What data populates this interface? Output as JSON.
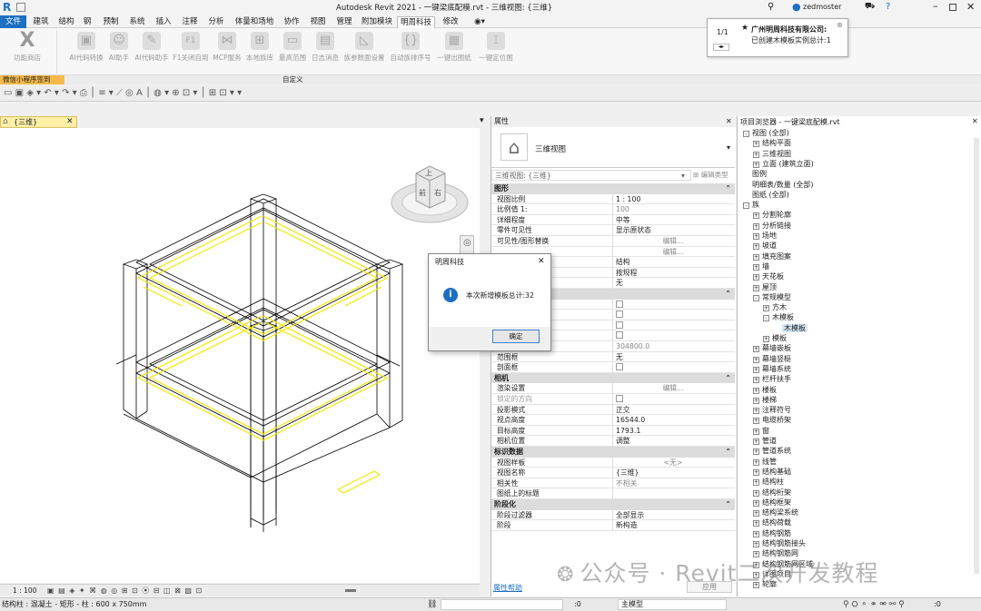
{
  "titlebar": {
    "title": "Autodesk Revit 2021 - 一键梁底配模.rvt - 三维视图: {三维}",
    "user": "zedmoster"
  },
  "ribbon_tabs": [
    "文件",
    "建筑",
    "结构",
    "钢",
    "预制",
    "系统",
    "插入",
    "注释",
    "分析",
    "体量和场地",
    "协作",
    "视图",
    "管理",
    "附加模块",
    "明周科技",
    "修改"
  ],
  "active_tab": "明周科技",
  "ribbon_buttons": [
    "功能商店",
    "AI代码转换",
    "AI助手",
    "AI代码助手",
    "F1关闭自用",
    "MCP服务",
    "本地族库",
    "最高范围",
    "日志消息",
    "族参数面设置",
    "自动族排序号",
    "一键出图纸",
    "一键定位图"
  ],
  "panel_labels": {
    "left": "微信小程序签到",
    "center": "自定义"
  },
  "notification": {
    "count": "1/1",
    "company": "广州明周科技有限公司:",
    "message": "已创建木模板实例总计:1"
  },
  "view_tab": "{三维}",
  "view_control": {
    "scale": "1 : 100"
  },
  "properties": {
    "header": "属性",
    "type_name": "三维视图",
    "selector": "三维视图: {三维}",
    "edit_type": "编辑类型",
    "rows": [
      {
        "kind": "sec",
        "k": "图形"
      },
      {
        "k": "视图比例",
        "v": "1 : 100"
      },
      {
        "k": "比例值 1:",
        "v": "100",
        "dim": true
      },
      {
        "k": "详细程度",
        "v": "中等"
      },
      {
        "k": "零件可见性",
        "v": "显示原状态"
      },
      {
        "k": "可见性/图形替换",
        "v": "编辑...",
        "btn": true
      },
      {
        "k": "",
        "v": "编辑...",
        "btn": true
      },
      {
        "k": "",
        "v": "结构"
      },
      {
        "k": "",
        "v": "按规程"
      },
      {
        "k": "",
        "v": "无"
      },
      {
        "kind": "sec",
        "k": ""
      },
      {
        "k": "",
        "v": "",
        "chk": true
      },
      {
        "k": "",
        "v": "",
        "chk": true
      },
      {
        "k": "",
        "v": "",
        "chk": true
      },
      {
        "k": "",
        "v": "",
        "chk": true
      },
      {
        "k": "远剪裁偏移",
        "v": "304800.0",
        "dim": true
      },
      {
        "k": "范围框",
        "v": "无"
      },
      {
        "k": "剖面框",
        "v": "",
        "chk": true
      },
      {
        "kind": "sec",
        "k": "相机"
      },
      {
        "k": "渲染设置",
        "v": "编辑...",
        "btn": true
      },
      {
        "k": "锁定的方向",
        "v": "",
        "chk": true,
        "dimk": true
      },
      {
        "k": "投影模式",
        "v": "正交"
      },
      {
        "k": "视点高度",
        "v": "16544.0"
      },
      {
        "k": "目标高度",
        "v": "1793.1"
      },
      {
        "k": "相机位置",
        "v": "调整"
      },
      {
        "kind": "sec",
        "k": "标识数据"
      },
      {
        "k": "视图样板",
        "v": "<无>",
        "btn": true
      },
      {
        "k": "视图名称",
        "v": "{三维}"
      },
      {
        "k": "相关性",
        "v": "不相关",
        "dim": true
      },
      {
        "k": "图纸上的标题",
        "v": ""
      },
      {
        "kind": "sec",
        "k": "阶段化"
      },
      {
        "k": "阶段过滤器",
        "v": "全部显示"
      },
      {
        "k": "阶段",
        "v": "新构造"
      }
    ],
    "help": "属性帮助",
    "apply": "应用"
  },
  "browser": {
    "title": "项目浏览器 - 一键梁底配模.rvt",
    "items": [
      {
        "t": "视图 (全部)",
        "l": 0,
        "e": "-"
      },
      {
        "t": "结构平面",
        "l": 1,
        "e": "+"
      },
      {
        "t": "三维视图",
        "l": 1,
        "e": "+"
      },
      {
        "t": "立面 (建筑立面)",
        "l": 1,
        "e": "+"
      },
      {
        "t": "图例",
        "l": 0,
        "e": ""
      },
      {
        "t": "明细表/数量 (全部)",
        "l": 0,
        "e": ""
      },
      {
        "t": "图纸 (全部)",
        "l": 0,
        "e": ""
      },
      {
        "t": "族",
        "l": 0,
        "e": "-"
      },
      {
        "t": "分割轮廓",
        "l": 1,
        "e": "+"
      },
      {
        "t": "分析链接",
        "l": 1,
        "e": "+"
      },
      {
        "t": "场地",
        "l": 1,
        "e": "+"
      },
      {
        "t": "坡道",
        "l": 1,
        "e": "+"
      },
      {
        "t": "填充图案",
        "l": 1,
        "e": "+"
      },
      {
        "t": "墙",
        "l": 1,
        "e": "+"
      },
      {
        "t": "天花板",
        "l": 1,
        "e": "+"
      },
      {
        "t": "屋顶",
        "l": 1,
        "e": "+"
      },
      {
        "t": "常规模型",
        "l": 1,
        "e": "-"
      },
      {
        "t": "方木",
        "l": 2,
        "e": "+"
      },
      {
        "t": "木模板",
        "l": 2,
        "e": "-"
      },
      {
        "t": "木模板",
        "l": 3,
        "e": "",
        "sel": true
      },
      {
        "t": "模板",
        "l": 2,
        "e": "+"
      },
      {
        "t": "幕墙嵌板",
        "l": 1,
        "e": "+"
      },
      {
        "t": "幕墙竖梃",
        "l": 1,
        "e": "+"
      },
      {
        "t": "幕墙系统",
        "l": 1,
        "e": "+"
      },
      {
        "t": "栏杆扶手",
        "l": 1,
        "e": "+"
      },
      {
        "t": "楼板",
        "l": 1,
        "e": "+"
      },
      {
        "t": "楼梯",
        "l": 1,
        "e": "+"
      },
      {
        "t": "注释符号",
        "l": 1,
        "e": "+"
      },
      {
        "t": "电缆桥架",
        "l": 1,
        "e": "+"
      },
      {
        "t": "窗",
        "l": 1,
        "e": "+"
      },
      {
        "t": "管道",
        "l": 1,
        "e": "+"
      },
      {
        "t": "管道系统",
        "l": 1,
        "e": "+"
      },
      {
        "t": "线管",
        "l": 1,
        "e": "+"
      },
      {
        "t": "结构基础",
        "l": 1,
        "e": "+"
      },
      {
        "t": "结构柱",
        "l": 1,
        "e": "+"
      },
      {
        "t": "结构桁架",
        "l": 1,
        "e": "+"
      },
      {
        "t": "结构框架",
        "l": 1,
        "e": "+"
      },
      {
        "t": "结构梁系统",
        "l": 1,
        "e": "+"
      },
      {
        "t": "结构荷载",
        "l": 1,
        "e": "+"
      },
      {
        "t": "结构钢筋",
        "l": 1,
        "e": "+"
      },
      {
        "t": "结构钢筋接头",
        "l": 1,
        "e": "+"
      },
      {
        "t": "结构钢筋网",
        "l": 1,
        "e": "+"
      },
      {
        "t": "结构钢筋网区域",
        "l": 1,
        "e": "+"
      },
      {
        "t": "详图项目",
        "l": 1,
        "e": "+"
      },
      {
        "t": "轮廓",
        "l": 1,
        "e": "+"
      }
    ]
  },
  "dialog": {
    "title": "明周科技",
    "message": "本次新增模板总计:32",
    "ok": "确定"
  },
  "status": {
    "left": "结构柱 : 混凝土 - 矩形 - 柱 : 600 x 750mm",
    "zero": ":0",
    "model": "主模型",
    "right_zero": ":0"
  },
  "watermark": "公众号 · Revit二次开发教程",
  "colors": {
    "accent": "#1d6fc2",
    "highlight": "#f2e800",
    "view_tab": "#fff0a8"
  }
}
